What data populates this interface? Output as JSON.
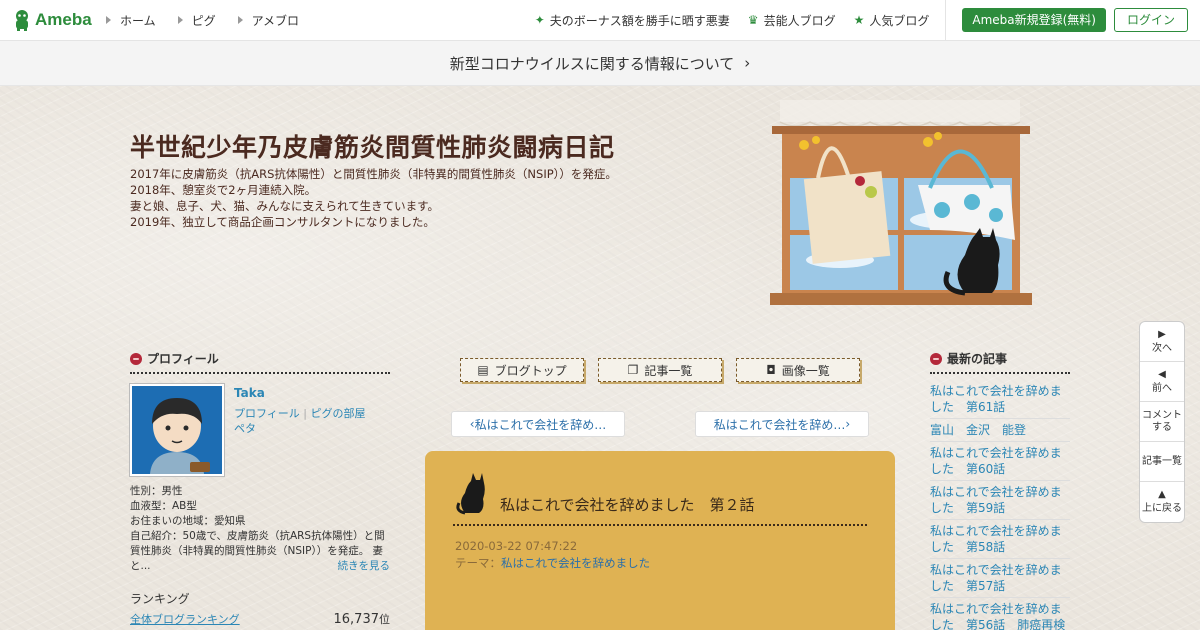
{
  "header": {
    "logo": "Ameba",
    "nav": [
      "ホーム",
      "ピグ",
      "アメブロ"
    ],
    "trending": "夫のボーナス額を勝手に晒す悪妻",
    "celebrity_blog": "芸能人ブログ",
    "popular_blog": "人気ブログ",
    "register": "Ameba新規登録(無料)",
    "login": "ログイン"
  },
  "notice": "新型コロナウイルスに関する情報について",
  "blog": {
    "title": "半世紀少年乃皮膚筋炎間質性肺炎闘病日記",
    "description": [
      "2017年に皮膚筋炎（抗ARS抗体陽性）と間質性肺炎（非特異的間質性肺炎（NSIP））を発症。",
      "2018年、憩室炎で2ヶ月連続入院。",
      "妻と娘、息子、犬、猫、みんなに支えられて生きています。",
      "2019年、独立して商品企画コンサルタントになりました。"
    ]
  },
  "profile": {
    "section_title": "プロフィール",
    "name": "Taka",
    "link_profile": "プロフィール",
    "link_room": "ピグの部屋",
    "link_peta": "ペタ",
    "gender": "性別：男性",
    "blood": "血液型：AB型",
    "area": "お住まいの地域：愛知県",
    "intro": "自己紹介：50歳で、皮膚筋炎（抗ARS抗体陽性）と間質性肺炎（非特異的間質性肺炎（NSIP））を発症。 妻と...",
    "more": "続きを見る",
    "ranking_title": "ランキング",
    "ranking_label": "全体ブログランキング",
    "ranking_value": "16,737",
    "ranking_unit": "位"
  },
  "tabs": {
    "top": "ブログトップ",
    "list": "記事一覧",
    "images": "画像一覧"
  },
  "pager": {
    "prev": "私はこれで会社を辞め…",
    "next": "私はこれで会社を辞め…"
  },
  "article": {
    "title": "私はこれで会社を辞めました　第２話",
    "date": "2020-03-22 07:47:22",
    "theme_label": "テーマ：",
    "theme": "私はこれで会社を辞めました"
  },
  "recent": {
    "title": "最新の記事",
    "items": [
      "私はこれで会社を辞めました　第61話",
      "富山　金沢　能登",
      "私はこれで会社を辞めました　第60話",
      "私はこれで会社を辞めました　第59話",
      "私はこれで会社を辞めました　第58話",
      "私はこれで会社を辞めました　第57話",
      "私はこれで会社を辞めました　第56話　肺癌再検"
    ]
  },
  "side_nav": {
    "next": "次へ",
    "prev": "前へ",
    "comment": "コメントする",
    "list": "記事一覧",
    "top": "上に戻る"
  },
  "colors": {
    "brand": "#2d8c3c",
    "article_bg": "#dfb253",
    "title_brown": "#4b2a20",
    "link": "#2b86b5"
  }
}
